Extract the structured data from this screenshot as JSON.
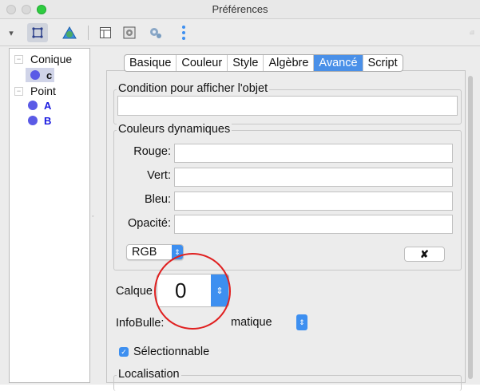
{
  "window": {
    "title": "Préférences"
  },
  "toolbar": {
    "items": [
      {
        "name": "menu-arrow-icon",
        "glyph": "▾"
      },
      {
        "name": "selection-tool-icon",
        "glyph": "⌗"
      },
      {
        "name": "graphics-icon",
        "glyph": "▲"
      },
      {
        "name": "layout-icon",
        "glyph": "▤"
      },
      {
        "name": "settings-icon",
        "glyph": "⚙"
      },
      {
        "name": "advanced-gear-icon",
        "glyph": "✲"
      },
      {
        "name": "more-options-icon",
        "glyph": "⋮"
      }
    ],
    "right_glyph": "◽"
  },
  "tree": {
    "groups": [
      {
        "label": "Conique",
        "items": [
          {
            "label": "c",
            "selected": true
          }
        ]
      },
      {
        "label": "Point",
        "items": [
          {
            "label": "A"
          },
          {
            "label": "B"
          }
        ]
      }
    ]
  },
  "tabs": [
    "Basique",
    "Couleur",
    "Style",
    "Algèbre",
    "Avancé",
    "Script"
  ],
  "active_tab": "Avancé",
  "condition": {
    "legend": "Condition pour afficher l'objet",
    "value": ""
  },
  "dynamic_colors": {
    "legend": "Couleurs dynamiques",
    "fields": [
      {
        "label": "Rouge:",
        "value": ""
      },
      {
        "label": "Vert:",
        "value": ""
      },
      {
        "label": "Bleu:",
        "value": ""
      },
      {
        "label": "Opacité:",
        "value": ""
      }
    ],
    "mode": "RGB",
    "clear_button": "✘"
  },
  "layer": {
    "label": "Calque",
    "value": "0"
  },
  "tooltip": {
    "label": "InfoBulle:",
    "value": "matique"
  },
  "selectable": {
    "label": "Sélectionnable",
    "checked": true
  },
  "location": {
    "legend": "Localisation"
  },
  "colors": {
    "accent": "#3d8ff0",
    "active_tab": "#4a90e8",
    "highlight_circle": "#e02020",
    "point": "#5a5ae6"
  }
}
